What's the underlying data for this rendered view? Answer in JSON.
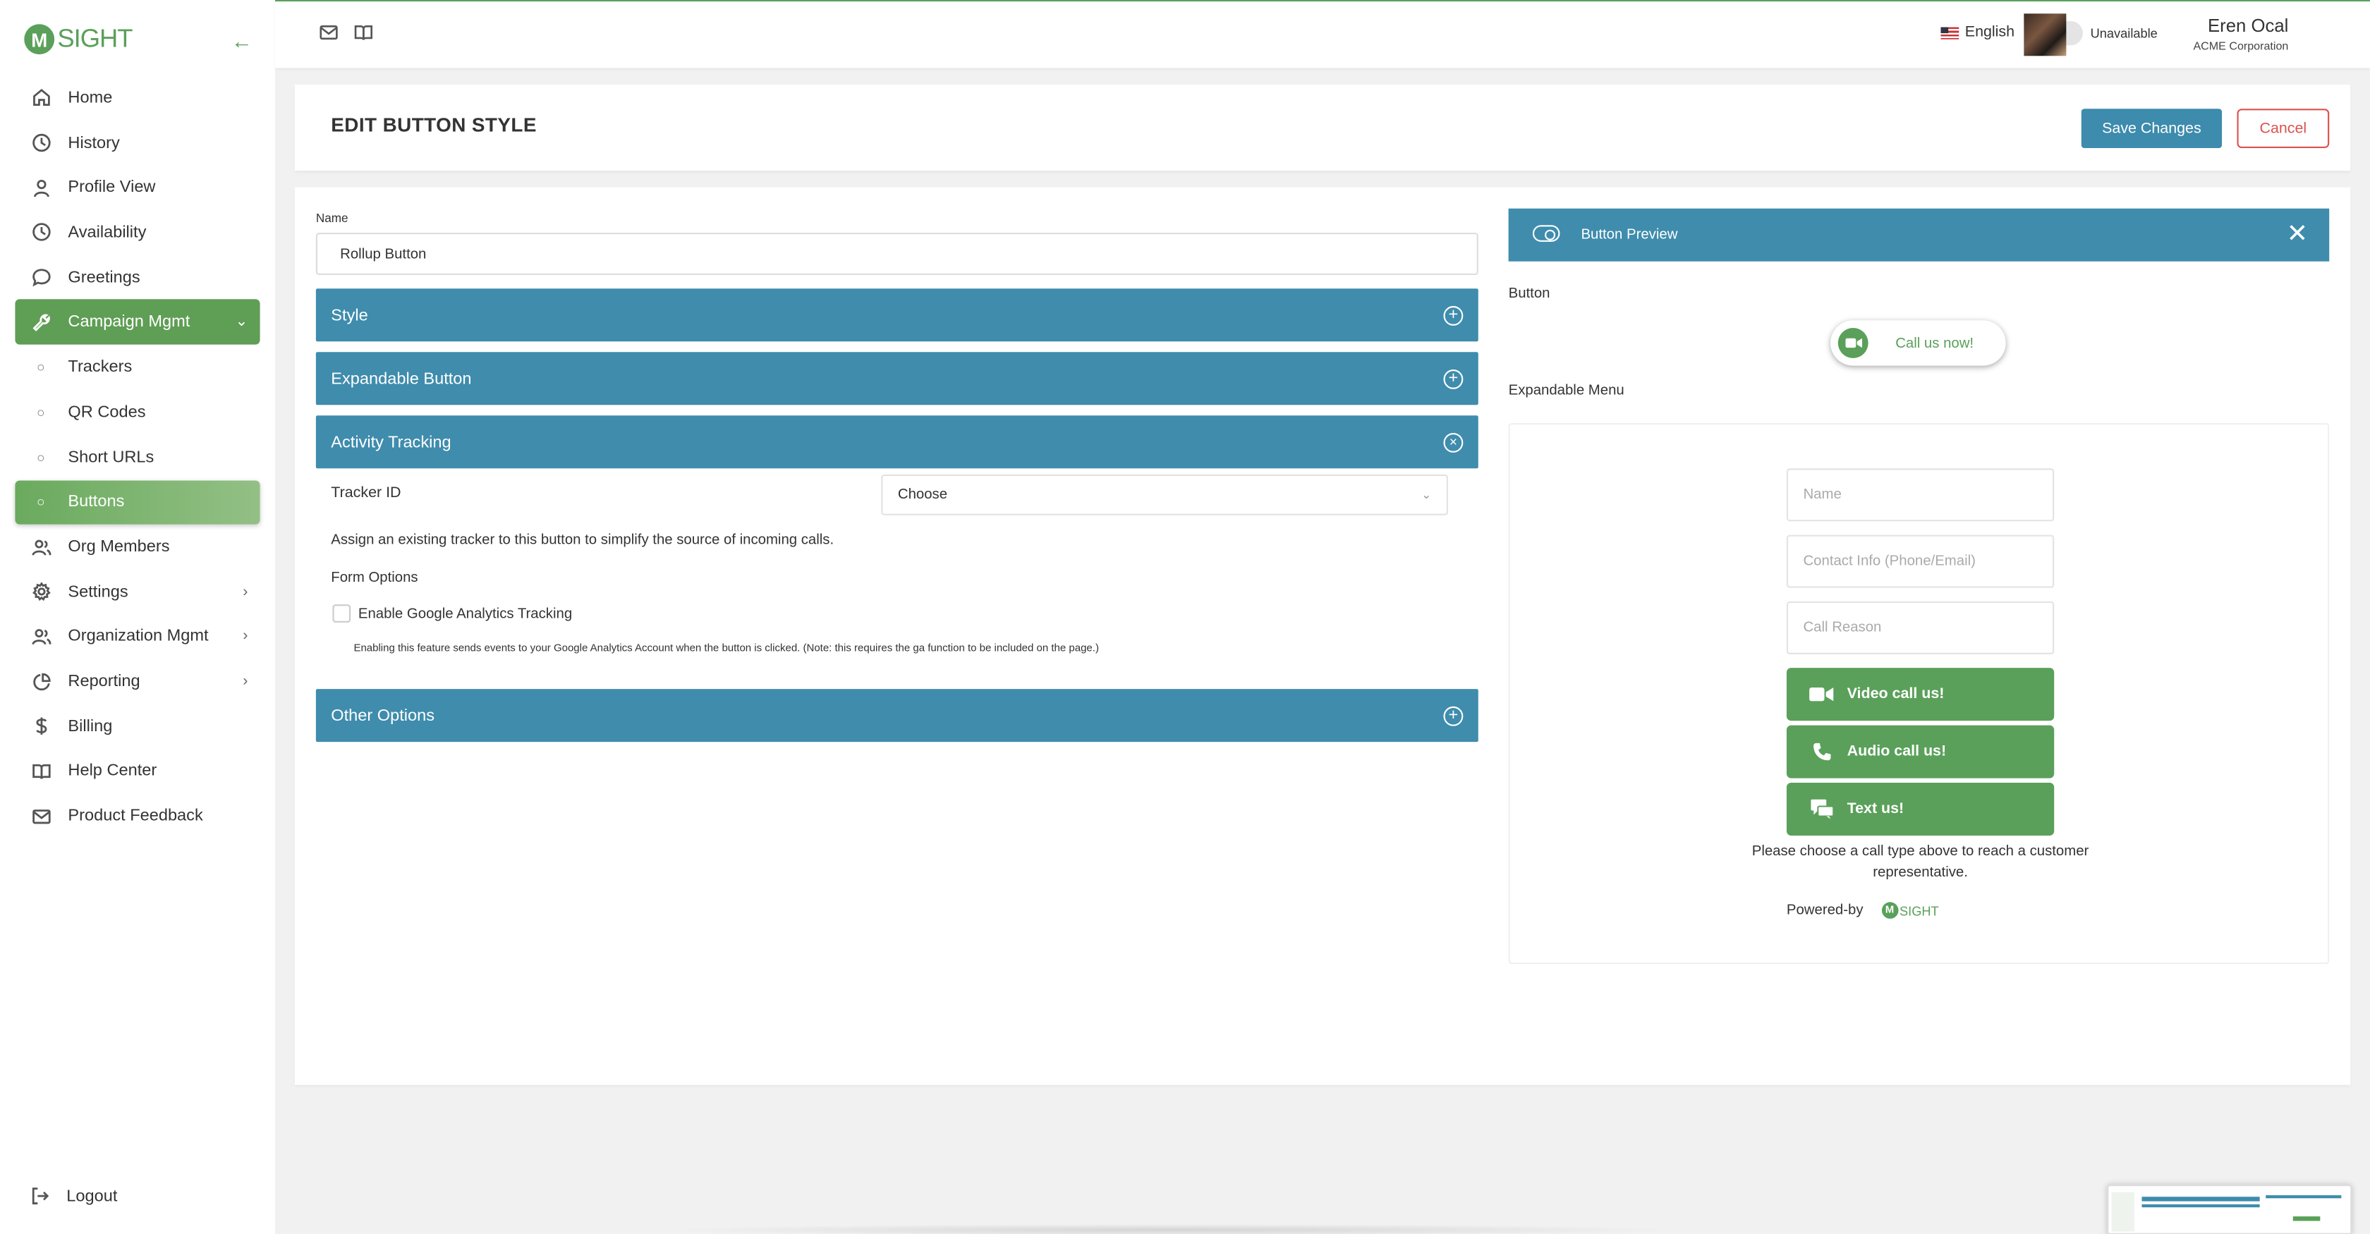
{
  "app": {
    "logo_text": "SIGHT",
    "logo_mark": "M"
  },
  "sidebar": {
    "items": [
      {
        "label": "Home",
        "icon": "home-icon"
      },
      {
        "label": "History",
        "icon": "clock-icon"
      },
      {
        "label": "Profile View",
        "icon": "user-icon"
      },
      {
        "label": "Availability",
        "icon": "clock-icon"
      },
      {
        "label": "Greetings",
        "icon": "chat-icon"
      },
      {
        "label": "Campaign Mgmt",
        "icon": "wrench-icon",
        "active": true,
        "chevron": "⌄"
      },
      {
        "label": "Trackers",
        "sub": true
      },
      {
        "label": "QR Codes",
        "sub": true
      },
      {
        "label": "Short URLs",
        "sub": true
      },
      {
        "label": "Buttons",
        "sub": true,
        "selected": true
      },
      {
        "label": "Org Members",
        "icon": "users-icon"
      },
      {
        "label": "Settings",
        "icon": "gear-icon",
        "chevron": "›"
      },
      {
        "label": "Organization Mgmt",
        "icon": "users-icon",
        "chevron": "›"
      },
      {
        "label": "Reporting",
        "icon": "pie-icon",
        "chevron": "›"
      },
      {
        "label": "Billing",
        "icon": "dollar-icon"
      },
      {
        "label": "Help Center",
        "icon": "book-icon"
      },
      {
        "label": "Product Feedback",
        "icon": "mail-icon"
      }
    ],
    "logout_label": "Logout"
  },
  "topbar": {
    "language": "English",
    "status": "Unavailable",
    "user_name": "Eren Ocal",
    "user_org": "ACME Corporation"
  },
  "header": {
    "title": "EDIT BUTTON STYLE",
    "save_label": "Save Changes",
    "cancel_label": "Cancel"
  },
  "form": {
    "name_label": "Name",
    "name_value": "Rollup Button",
    "sections": {
      "style": "Style",
      "expandable": "Expandable Button",
      "activity": "Activity Tracking",
      "other": "Other Options"
    },
    "tracker_label": "Tracker ID",
    "tracker_value": "Choose",
    "assign_text": "Assign an existing tracker to this button to simplify the source of incoming calls.",
    "form_options_label": "Form Options",
    "ga_label": "Enable Google Analytics Tracking",
    "ga_checked": false,
    "ga_note": "Enabling this feature sends events to your Google Analytics Account when the button is clicked. (Note: this requires the ga function to be included on the page.)"
  },
  "preview": {
    "title": "Button Preview",
    "button_label": "Button",
    "call_button_text": "Call us now!",
    "expandable_label": "Expandable Menu",
    "name_placeholder": "Name",
    "contact_placeholder": "Contact Info (Phone/Email)",
    "reason_placeholder": "Call Reason",
    "video_label": "Video call us!",
    "audio_label": "Audio call us!",
    "text_label": "Text us!",
    "choose_text": "Please choose a call type above to reach a customer representative.",
    "powered_by": "Powered-by",
    "brand_text": "SIGHT",
    "brand_mark": "M"
  },
  "colors": {
    "brand_green": "#5aa05a",
    "accent_blue": "#3f8cad",
    "cancel_red": "#d9534f"
  }
}
